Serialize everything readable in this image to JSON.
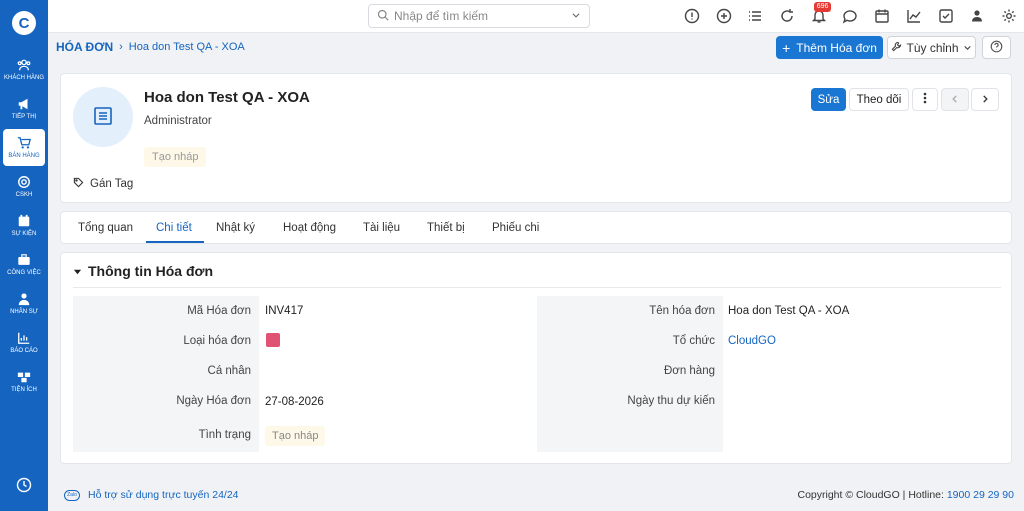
{
  "sidebar": {
    "logo": "C",
    "items": [
      {
        "label": "KHÁCH HÀNG",
        "icon": "users-icon"
      },
      {
        "label": "TIẾP THỊ",
        "icon": "megaphone-icon"
      },
      {
        "label": "BÁN HÀNG",
        "icon": "cart-icon",
        "active": true
      },
      {
        "label": "CSKH",
        "icon": "lifebuoy-icon"
      },
      {
        "label": "SỰ KIỆN",
        "icon": "calendar-icon"
      },
      {
        "label": "CÔNG VIỆC",
        "icon": "briefcase-icon"
      },
      {
        "label": "NHÂN SỰ",
        "icon": "person-icon"
      },
      {
        "label": "BÁO CÁO",
        "icon": "report-icon"
      },
      {
        "label": "TIỆN ÍCH",
        "icon": "boxes-icon"
      }
    ]
  },
  "topbar": {
    "search_placeholder": "Nhập để tìm kiếm",
    "notification_count": "696"
  },
  "breadcrumb": {
    "module": "HÓA ĐƠN",
    "record": "Hoa don Test QA - XOA"
  },
  "header_actions": {
    "add_label": "Thêm Hóa đơn",
    "custom_label": "Tùy chỉnh"
  },
  "record": {
    "title": "Hoa don Test QA - XOA",
    "owner": "Administrator",
    "status": "Tạo nháp",
    "tag_label": "Gán Tag",
    "edit_label": "Sửa",
    "follow_label": "Theo dõi"
  },
  "tabs": [
    "Tổng quan",
    "Chi tiết",
    "Nhật ký",
    "Hoạt động",
    "Tài liệu",
    "Thiết bị",
    "Phiếu chi"
  ],
  "section": {
    "title": "Thông tin Hóa đơn",
    "left_fields": [
      {
        "label": "Mã Hóa đơn",
        "value": "INV417"
      },
      {
        "label": "Loại hóa đơn",
        "value": ""
      },
      {
        "label": "Cá nhân",
        "value": ""
      },
      {
        "label": "Ngày Hóa đơn",
        "value": "27-08-2026"
      },
      {
        "label": "Tình trạng",
        "value": "Tạo nháp"
      }
    ],
    "right_fields": [
      {
        "label": "Tên hóa đơn",
        "value": "Hoa don Test QA - XOA"
      },
      {
        "label": "Tổ chức",
        "value": "CloudGO"
      },
      {
        "label": "Đơn hàng",
        "value": ""
      },
      {
        "label": "Ngày thu dự kiến",
        "value": ""
      }
    ],
    "type_color": "#e05372"
  },
  "footer": {
    "support": "Hỗ trợ sử dụng trực tuyến 24/24",
    "zalo": "Zalo",
    "copyright": "Copyright © CloudGO | Hotline: ",
    "hotline": "1900 29 29 90"
  }
}
